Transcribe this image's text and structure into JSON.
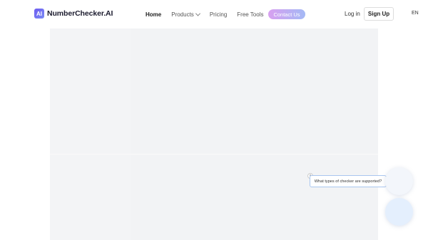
{
  "header": {
    "logo_badge": "AI",
    "logo_text": "NumberChecker.AI",
    "nav": {
      "home": "Home",
      "products": "Products",
      "pricing": "Pricing",
      "free_tools": "Free Tools"
    },
    "contact_label": "Contact Us",
    "login_label": "Log in",
    "signup_label": "Sign Up",
    "language": "EN"
  },
  "chat": {
    "prompt": "What types of checker are supported?",
    "close_symbol": "×"
  },
  "colors": {
    "accent_gradient_start": "#d8a0f0",
    "accent_gradient_end": "#a4b9f5",
    "logo_color": "#6d5bf0",
    "placeholder_bg": "#f2f3f5"
  }
}
